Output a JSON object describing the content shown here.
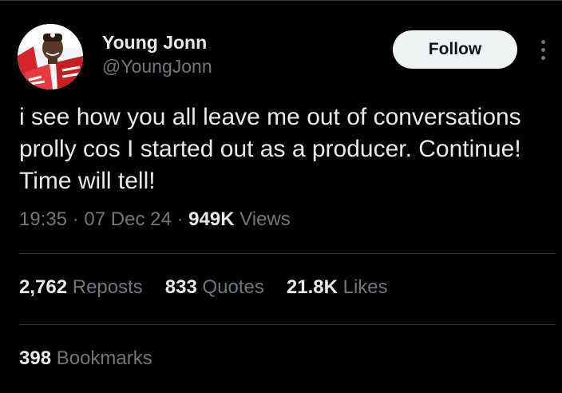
{
  "colors": {
    "background": "#000000",
    "text_primary": "#e7e9ea",
    "text_secondary": "#71767b",
    "divider": "#2f3336",
    "follow_bg": "#eff3f4",
    "follow_text": "#0f1419"
  },
  "author": {
    "name": "Young Jonn",
    "handle": "@YoungJonn"
  },
  "follow_label": "Follow",
  "more_icon": "more-vertical-icon",
  "tweet": {
    "lines": [
      "i see how you all leave me out of conversations",
      "prolly cos I started out as a producer. Continue!",
      "Time will tell!"
    ]
  },
  "meta": {
    "time": "19:35",
    "separator": "·",
    "date": "07 Dec 24",
    "views_count": "949K",
    "views_label": "Views"
  },
  "stats": {
    "reposts": {
      "count": "2,762",
      "label": "Reposts"
    },
    "quotes": {
      "count": "833",
      "label": "Quotes"
    },
    "likes": {
      "count": "21.8K",
      "label": "Likes"
    },
    "bookmarks": {
      "count": "398",
      "label": "Bookmarks"
    }
  }
}
